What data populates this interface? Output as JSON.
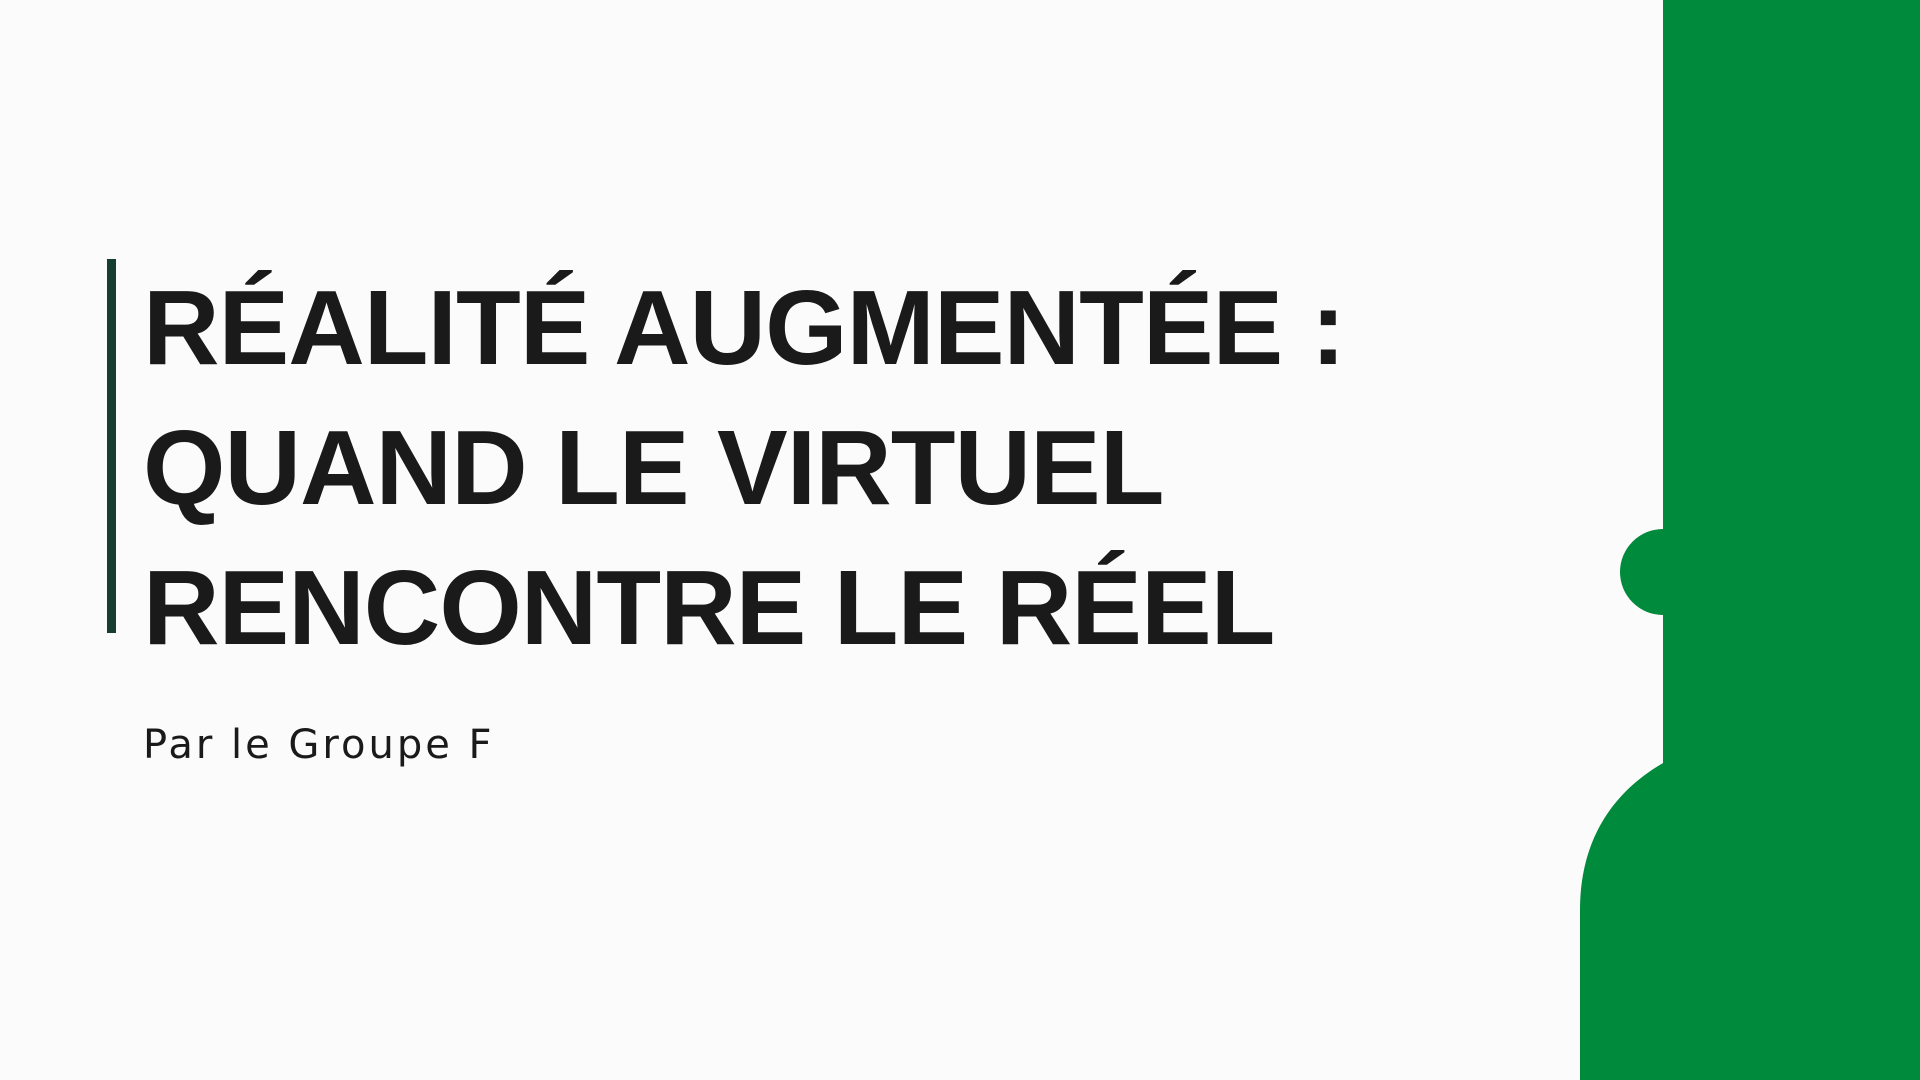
{
  "slide": {
    "title_lines": [
      "RÉALITÉ AUGMENTÉE :",
      "QUAND LE VIRTUEL",
      "RENCONTRE LE RÉEL"
    ],
    "subtitle": "Par le Groupe F"
  },
  "colors": {
    "background": "#fcfbfc",
    "text": "#1a1a1a",
    "accent_bar": "#163d2f",
    "brand_green": "#008a3c"
  }
}
